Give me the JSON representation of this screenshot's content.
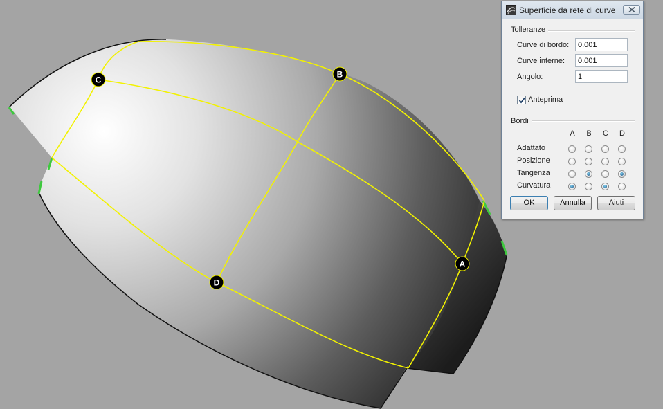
{
  "viewport": {
    "markers": [
      "A",
      "B",
      "C",
      "D"
    ]
  },
  "dialog": {
    "title": "Superficie da rete di curve",
    "tolerances": {
      "group_label": "Tolleranze",
      "edge_curves_label": "Curve di bordo:",
      "edge_curves_value": "0.001",
      "interior_curves_label": "Curve interne:",
      "interior_curves_value": "0.001",
      "angle_label": "Angolo:",
      "angle_value": "1"
    },
    "preview": {
      "label": "Anteprima",
      "checked": true
    },
    "edges": {
      "group_label": "Bordi",
      "columns": [
        "A",
        "B",
        "C",
        "D"
      ],
      "rows": [
        {
          "label": "Adattato",
          "selected": []
        },
        {
          "label": "Posizione",
          "selected": []
        },
        {
          "label": "Tangenza",
          "selected": [
            "B",
            "D"
          ]
        },
        {
          "label": "Curvatura",
          "selected": [
            "A",
            "C"
          ]
        }
      ]
    },
    "buttons": {
      "ok": "OK",
      "cancel": "Annulla",
      "help": "Aiuti"
    }
  }
}
